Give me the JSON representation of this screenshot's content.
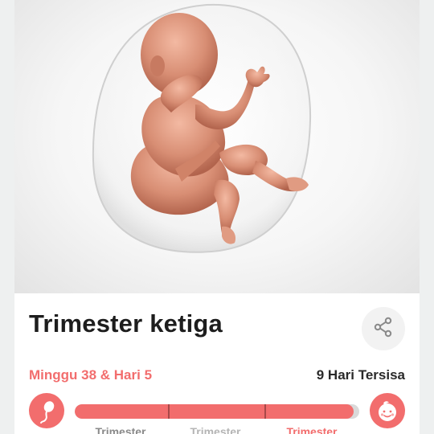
{
  "stage": {
    "title": "Trimester ketiga",
    "week_day": "Minggu 38 & Hari 5",
    "days_remaining": "9 Hari Tersisa",
    "progress_fraction": 0.98
  },
  "trimesters": [
    {
      "label": "Trimester",
      "color": "#8a8a8a"
    },
    {
      "label": "Trimester",
      "color": "#b5b5b5"
    },
    {
      "label": "Trimester",
      "color": "#f26d6d"
    }
  ],
  "icons": {
    "share": "share-icon",
    "start": "sperm-icon",
    "end": "baby-face-icon"
  },
  "colors": {
    "accent": "#f26d6d",
    "track": "#d9d9d9"
  }
}
